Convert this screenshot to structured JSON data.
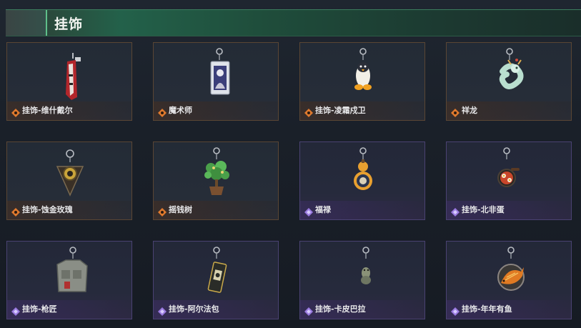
{
  "header": {
    "title": "挂饰"
  },
  "colors": {
    "orange_rarity": "#e07a2e",
    "purple_rarity": "#9a7ae0",
    "header_green": "#23614a"
  },
  "items": [
    {
      "label": "挂饰-维什戴尔",
      "rarity": "orange",
      "icon": "red-blade-charm-icon"
    },
    {
      "label": "魔术师",
      "rarity": "orange",
      "icon": "magician-card-charm-icon"
    },
    {
      "label": "挂饰-凌霜戍卫",
      "rarity": "orange",
      "icon": "penguin-charm-icon"
    },
    {
      "label": "祥龙",
      "rarity": "orange",
      "icon": "jade-dragon-charm-icon"
    },
    {
      "label": "挂饰-蚀金玫瑰",
      "rarity": "orange",
      "icon": "gold-rose-emblem-charm-icon"
    },
    {
      "label": "摇钱树",
      "rarity": "orange",
      "icon": "money-tree-charm-icon"
    },
    {
      "label": "福禄",
      "rarity": "purple",
      "icon": "gourd-charm-icon"
    },
    {
      "label": "挂饰-北非蛋",
      "rarity": "purple",
      "icon": "shakshuka-pan-charm-icon"
    },
    {
      "label": "挂饰-枪匠",
      "rarity": "purple",
      "icon": "vest-charm-icon"
    },
    {
      "label": "挂饰-阿尔法包",
      "rarity": "purple",
      "icon": "alpha-pack-charm-icon"
    },
    {
      "label": "挂饰-卡皮巴拉",
      "rarity": "purple",
      "icon": "capybara-charm-icon"
    },
    {
      "label": "挂饰-年年有鱼",
      "rarity": "purple",
      "icon": "fish-plate-charm-icon"
    }
  ]
}
